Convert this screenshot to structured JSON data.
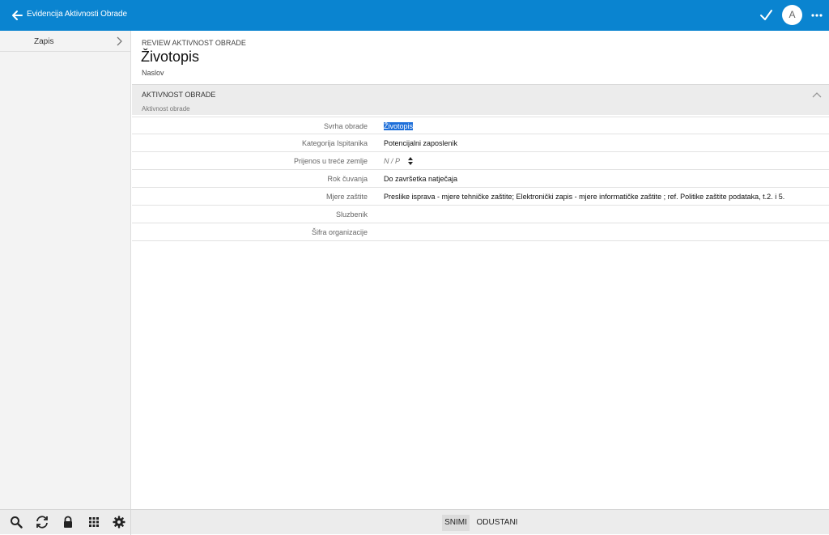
{
  "header": {
    "title": "Evidencija Aktivnosti Obrade",
    "avatar_letter": "A",
    "accent_color": "#0a84d0"
  },
  "sidebar": {
    "items": [
      {
        "label": "Zapis",
        "icon": "chevron-right-icon"
      }
    ]
  },
  "record": {
    "caption": "REVIEW AKTIVNOST OBRADE",
    "title": "Životopis",
    "subtitle": "Naslov"
  },
  "section": {
    "title": "AKTIVNOST OBRADE",
    "subtitle": "Aktivnost obrade"
  },
  "fields": [
    {
      "label": "Svrha obrade",
      "value": "Životopis"
    },
    {
      "label": "Kategorija Ispitanika",
      "value": "Potencijalni zaposlenik"
    },
    {
      "label": "Prijenos u treće zemlje",
      "value": "N / P"
    },
    {
      "label": "Rok čuvanja",
      "value": "Do završetka natječaja"
    },
    {
      "label": "Mjere zaštite",
      "value": "Preslike isprava - mjere tehničke zaštite; Elektronički zapis - mjere informatičke zaštite ; ref. Politike zaštite podataka, t.2. i 5."
    },
    {
      "label": "Sluzbenik",
      "value": ""
    },
    {
      "label": "Šifra organizacije",
      "value": ""
    }
  ],
  "toolbar": {
    "icons": [
      "search-icon",
      "sync-icon",
      "lock-icon",
      "apps-grid-icon",
      "gear-icon"
    ],
    "save_label": "SNIMI",
    "cancel_label": "ODUSTANI"
  }
}
